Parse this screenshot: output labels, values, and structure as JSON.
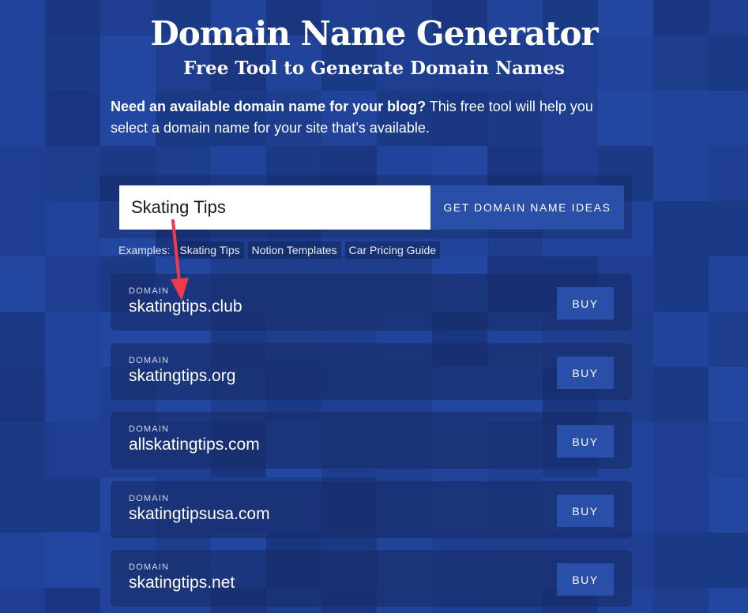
{
  "header": {
    "title": "Domain Name Generator",
    "subtitle": "Free Tool to Generate Domain Names"
  },
  "intro": {
    "bold": "Need an available domain name for your blog?",
    "text": " This free tool will help you select a domain name for your site that’s available."
  },
  "search": {
    "value": "Skating Tips",
    "button_label": "GET DOMAIN NAME IDEAS"
  },
  "examples": {
    "label": "Examples:",
    "items": [
      "Skating Tips",
      "Notion Templates",
      "Car Pricing Guide"
    ]
  },
  "results": [
    {
      "label": "DOMAIN",
      "domain": "skatingtips.club",
      "buy_label": "BUY"
    },
    {
      "label": "DOMAIN",
      "domain": "skatingtips.org",
      "buy_label": "BUY"
    },
    {
      "label": "DOMAIN",
      "domain": "allskatingtips.com",
      "buy_label": "BUY"
    },
    {
      "label": "DOMAIN",
      "domain": "skatingtipsusa.com",
      "buy_label": "BUY"
    },
    {
      "label": "DOMAIN",
      "domain": "skatingtips.net",
      "buy_label": "BUY"
    }
  ],
  "colors": {
    "background": "#1e3f91",
    "button": "#2a4fa8",
    "annotation_arrow": "#f03a4a"
  }
}
